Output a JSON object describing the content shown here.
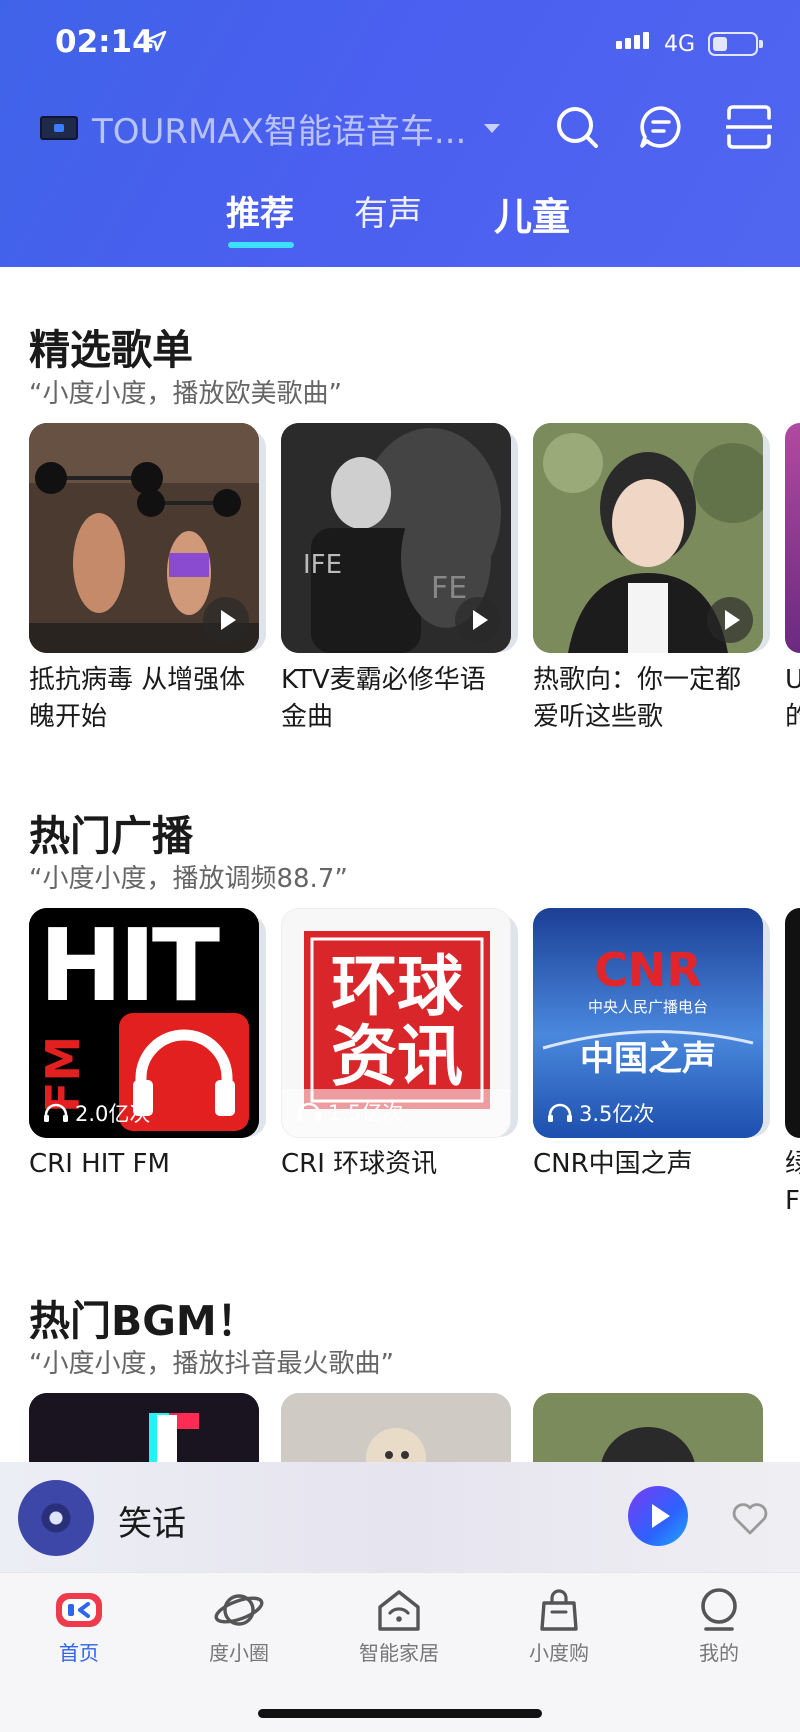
{
  "status_bar": {
    "time": "02:14",
    "network": "4G"
  },
  "header": {
    "device_name": "TOURMAX智能语音车...",
    "tabs": [
      {
        "label": "推荐"
      },
      {
        "label": "有声"
      },
      {
        "label": "儿童"
      }
    ]
  },
  "sections": [
    {
      "title": "精选歌单",
      "subtitle": "“小度小度，播放欧美歌曲”",
      "items": [
        {
          "caption": "抵抗病毒 从增强体魄开始"
        },
        {
          "caption": "KTV麦霸必修华语金曲"
        },
        {
          "caption": "热歌向：你一定都爱听这些歌"
        }
      ]
    },
    {
      "title": "热门广播",
      "subtitle": "“小度小度，播放调频88.7”",
      "items": [
        {
          "caption": "CRI HIT FM",
          "plays": "2.0亿次",
          "logo_text": "HIT",
          "logo_sub": "FM"
        },
        {
          "caption": "CRI 环球资讯",
          "plays": "1.5亿次",
          "logo_text": "环球资讯"
        },
        {
          "caption": "CNR中国之声",
          "plays": "3.5亿次",
          "logo_text": "CNR",
          "logo_sub": "中央人民广播电台",
          "logo_name": "中国之声"
        }
      ]
    },
    {
      "title": "热门BGM！",
      "subtitle": "“小度小度，播放抖音最火歌曲”"
    }
  ],
  "player": {
    "title": "笑话"
  },
  "bottom_nav": [
    {
      "label": "首页",
      "icon": "home-icon",
      "active": true
    },
    {
      "label": "度小圈",
      "icon": "planet-icon"
    },
    {
      "label": "智能家居",
      "icon": "smart-home-icon"
    },
    {
      "label": "小度购",
      "icon": "shopping-bag-icon"
    },
    {
      "label": "我的",
      "icon": "profile-icon"
    }
  ],
  "colors": {
    "header": "#4b5ff0",
    "accent": "#2f63f0",
    "tab_underline": "#3de0ff"
  }
}
